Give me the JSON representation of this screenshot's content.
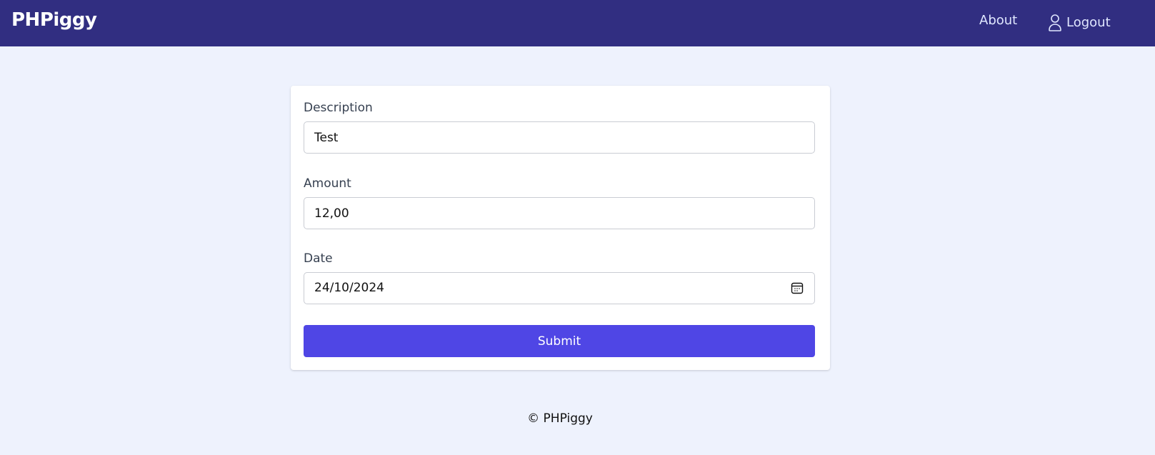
{
  "header": {
    "brand": "PHPiggy",
    "nav": {
      "about": "About",
      "logout": "Logout"
    }
  },
  "form": {
    "description": {
      "label": "Description",
      "value": "Test"
    },
    "amount": {
      "label": "Amount",
      "value": "12,00"
    },
    "date": {
      "label": "Date",
      "value": "24/10/2024"
    },
    "submit_label": "Submit"
  },
  "footer": {
    "text": "© PHPiggy"
  },
  "icons": {
    "user": "user-icon",
    "calendar": "calendar-icon"
  },
  "colors": {
    "header_bg": "#312e81",
    "page_bg": "#eef2fd",
    "primary_button": "#4f46e5"
  }
}
